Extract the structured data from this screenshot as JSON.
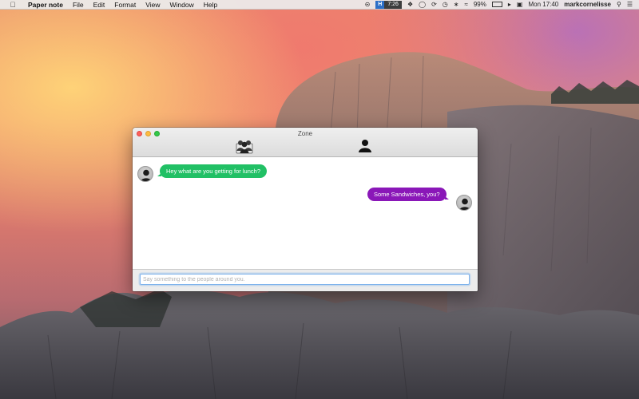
{
  "menubar": {
    "apple_icon": "apple-icon",
    "app_name": "Paper note",
    "menus": [
      "File",
      "Edit",
      "Format",
      "View",
      "Window",
      "Help"
    ],
    "status": {
      "badge_letter": "H",
      "badge_time": "7:26",
      "battery_level": "99%",
      "datetime": "Mon 17:40",
      "username": "markcornelisse"
    }
  },
  "window": {
    "title": "Zone",
    "toolbar": {
      "group_icon": "group-people-icon",
      "person_icon": "person-icon"
    },
    "messages": [
      {
        "direction": "incoming",
        "text": "Hey what are you getting for lunch?",
        "color": "#21c065"
      },
      {
        "direction": "outgoing",
        "text": "Some Sandwiches, you?",
        "color": "#8a17b8"
      }
    ],
    "input": {
      "value": "",
      "placeholder": "Say something to the people around you."
    }
  },
  "colors": {
    "close": "#fc605b",
    "minimize": "#fdbc40",
    "maximize": "#34c84a",
    "input_focus": "#7fb3ec"
  }
}
